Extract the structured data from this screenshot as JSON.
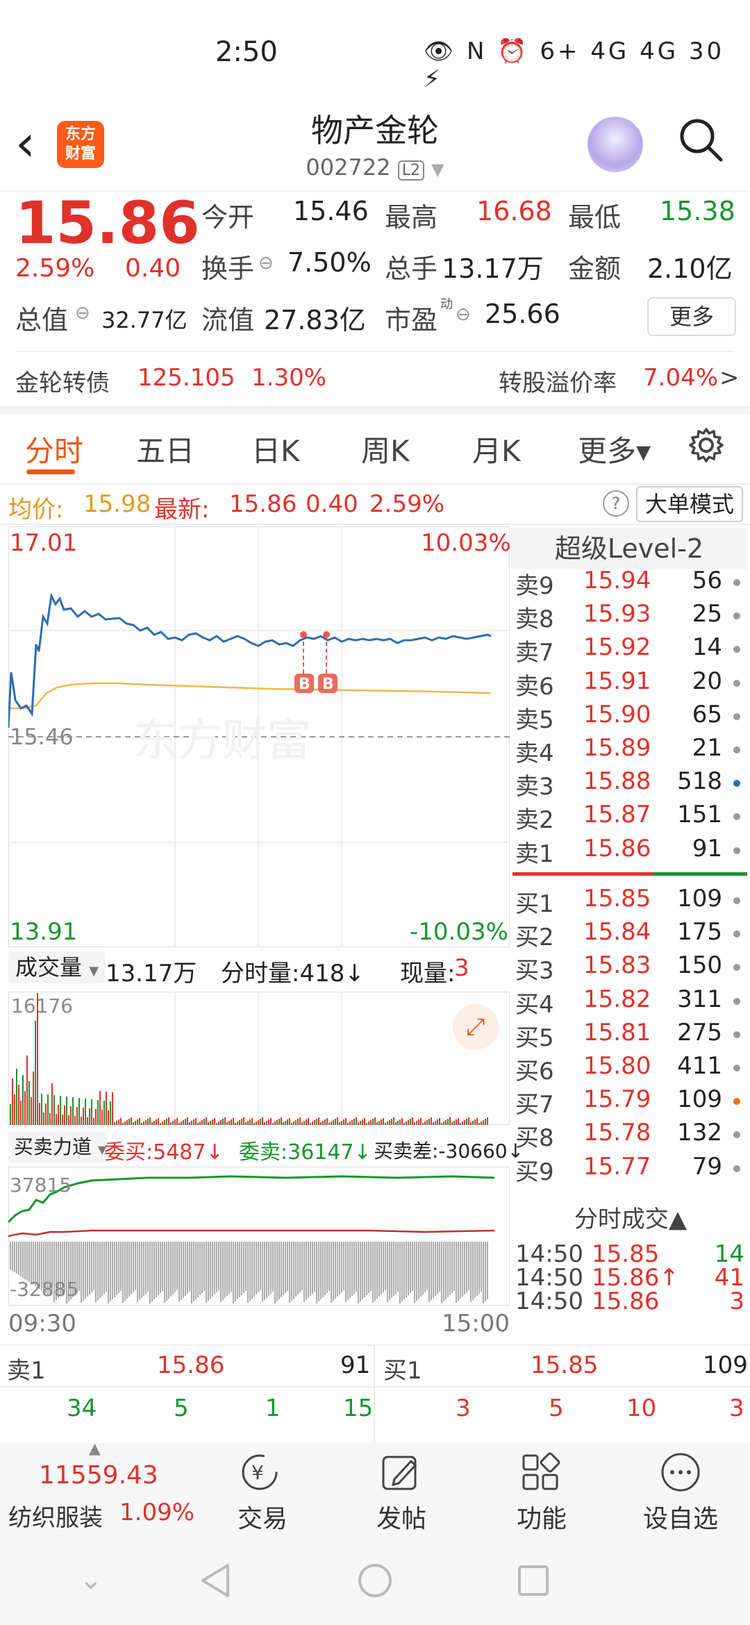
{
  "status": {
    "time": "2:50",
    "icons": "👁 N ⏰ 6+ 4G 4G 30 ⚡",
    "battery": "30"
  },
  "header": {
    "title": "物产金轮",
    "code": "002722",
    "level": "L2",
    "logo_line1": "东方",
    "logo_line2": "财富"
  },
  "quote": {
    "price": "15.86",
    "pct": "2.59%",
    "chg": "0.40",
    "open_label": "今开",
    "open": "15.46",
    "high_label": "最高",
    "high": "16.68",
    "low_label": "最低",
    "low": "15.38",
    "turnover_label": "换手",
    "turnover": "7.50%",
    "volume_label": "总手",
    "volume": "13.17万",
    "amount_label": "金额",
    "amount": "2.10亿",
    "mcap_label": "总值",
    "mcap": "32.77亿",
    "float_label": "流值",
    "float": "27.83亿",
    "pe_label": "市盈",
    "pe_sup": "动",
    "pe": "25.66",
    "more": "更多"
  },
  "bond": {
    "name": "金轮转债",
    "price": "125.105",
    "pct": "1.30%",
    "premium_label": "转股溢价率",
    "premium": "7.04%",
    "arrow": ">"
  },
  "tabs": [
    "分时",
    "五日",
    "日K",
    "周K",
    "月K",
    "更多▾"
  ],
  "info": {
    "avg_label": "均价:",
    "avg": "15.98",
    "latest_label": "最新:",
    "latest": "15.86",
    "chg": "0.40",
    "pct": "2.59%",
    "help": "?",
    "mode": "大单模式"
  },
  "chart": {
    "top_price": "17.01",
    "top_pct": "10.03%",
    "ref_price": "15.46",
    "bottom_price": "13.91",
    "bottom_pct": "-10.03%",
    "watermark": "东方财富",
    "marker": "B",
    "time_start": "09:30",
    "time_end": "15:00"
  },
  "volume": {
    "label": "成交量",
    "total": "13.17万",
    "min_label": "分时量:418↓",
    "now_label": "现量:",
    "now": "3",
    "max": "16176"
  },
  "force": {
    "label": "买卖力道",
    "buy": "委买:5487↓",
    "sell": "委卖:36147↓",
    "diff": "买卖差:-30660↓",
    "top": "37815",
    "bottom": "-32885"
  },
  "orderbook": {
    "title": "超级Level-2",
    "asks": [
      {
        "label": "卖9",
        "price": "15.94",
        "vol": "56"
      },
      {
        "label": "卖8",
        "price": "15.93",
        "vol": "25"
      },
      {
        "label": "卖7",
        "price": "15.92",
        "vol": "14"
      },
      {
        "label": "卖6",
        "price": "15.91",
        "vol": "20"
      },
      {
        "label": "卖5",
        "price": "15.90",
        "vol": "65"
      },
      {
        "label": "卖4",
        "price": "15.89",
        "vol": "21"
      },
      {
        "label": "卖3",
        "price": "15.88",
        "vol": "518"
      },
      {
        "label": "卖2",
        "price": "15.87",
        "vol": "151"
      },
      {
        "label": "卖1",
        "price": "15.86",
        "vol": "91"
      }
    ],
    "bids": [
      {
        "label": "买1",
        "price": "15.85",
        "vol": "109"
      },
      {
        "label": "买2",
        "price": "15.84",
        "vol": "175"
      },
      {
        "label": "买3",
        "price": "15.83",
        "vol": "150"
      },
      {
        "label": "买4",
        "price": "15.82",
        "vol": "311"
      },
      {
        "label": "买5",
        "price": "15.81",
        "vol": "275"
      },
      {
        "label": "买6",
        "price": "15.80",
        "vol": "411"
      },
      {
        "label": "买7",
        "price": "15.79",
        "vol": "109"
      },
      {
        "label": "买8",
        "price": "15.78",
        "vol": "132"
      },
      {
        "label": "买9",
        "price": "15.77",
        "vol": "79"
      }
    ]
  },
  "ticks": {
    "title": "分时成交▲",
    "rows": [
      {
        "time": "14:50",
        "price": "15.85",
        "vol": "14",
        "color": "green"
      },
      {
        "time": "14:50",
        "price": "15.86↑",
        "vol": "41",
        "color": "red"
      },
      {
        "time": "14:50",
        "price": "15.86",
        "vol": "3",
        "color": "red"
      }
    ]
  },
  "bottom_book": {
    "left": {
      "label": "卖1",
      "price": "15.86",
      "vol": "91",
      "queue": [
        "34",
        "5",
        "1",
        "15"
      ]
    },
    "right": {
      "label": "买1",
      "price": "15.85",
      "vol": "109",
      "queue": [
        "3",
        "5",
        "10",
        "3"
      ]
    }
  },
  "bottom_bar": {
    "index_value": "11559.43",
    "index_name": "纺织服装",
    "index_pct": "1.09%",
    "trade": "交易",
    "post": "发帖",
    "func": "功能",
    "watch": "设自选"
  },
  "colors": {
    "up": "#e0312b",
    "down": "#17952e",
    "price_line": "#2c6db3",
    "avg_line": "#f0b848",
    "accent": "#e65a12"
  }
}
